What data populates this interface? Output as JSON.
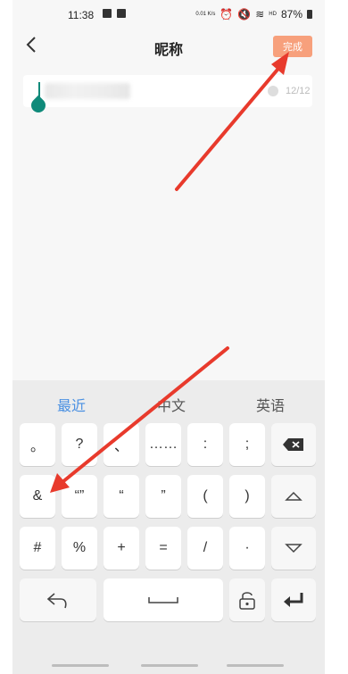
{
  "status_bar": {
    "time": "11:38",
    "net_speed": "0.01 K/s",
    "battery": "87%"
  },
  "header": {
    "title": "昵称",
    "done_label": "完成"
  },
  "nickname_input": {
    "counter": "12/12"
  },
  "keyboard": {
    "tabs": {
      "recent": "最近",
      "chinese": "中文",
      "english": "英语"
    },
    "row1": [
      "。",
      "?",
      "、",
      "……",
      ":",
      ";"
    ],
    "row2": [
      "&",
      "“”",
      "“",
      "”",
      "(",
      ")"
    ],
    "row3": [
      "#",
      "%",
      "+",
      "=",
      "/",
      "·"
    ]
  },
  "colors": {
    "accent": "#f7a07c",
    "cursor": "#0f8a7a",
    "tab_active": "#4a90e2",
    "annotation_arrow": "#e83a2c"
  }
}
